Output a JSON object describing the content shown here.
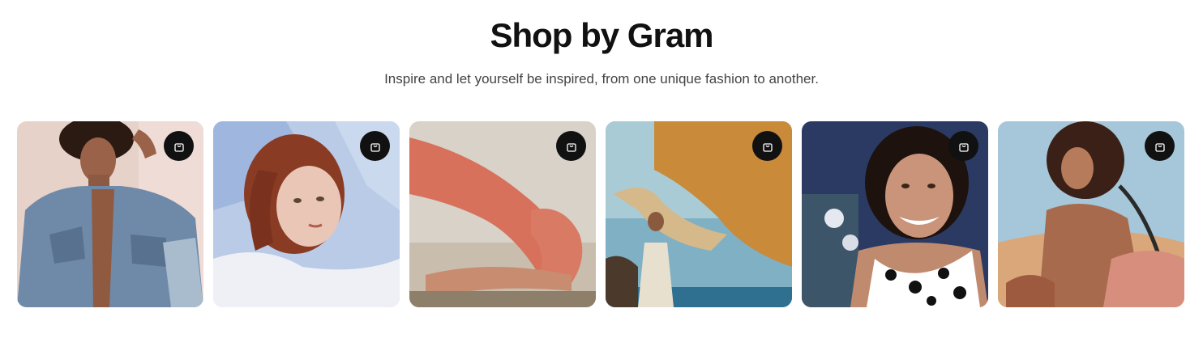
{
  "section": {
    "title": "Shop by Gram",
    "subtitle": "Inspire and let yourself be inspired, from one unique fashion to another."
  },
  "cards": [
    {
      "name": "gram-post-denim-jacket",
      "icon": "shopping-bag-icon"
    },
    {
      "name": "gram-post-redhead-portrait",
      "icon": "shopping-bag-icon"
    },
    {
      "name": "gram-post-coral-activewear",
      "icon": "shopping-bag-icon"
    },
    {
      "name": "gram-post-sea-scarf",
      "icon": "shopping-bag-icon"
    },
    {
      "name": "gram-post-polka-dot-top",
      "icon": "shopping-bag-icon"
    },
    {
      "name": "gram-post-desert-bag",
      "icon": "shopping-bag-icon"
    }
  ]
}
